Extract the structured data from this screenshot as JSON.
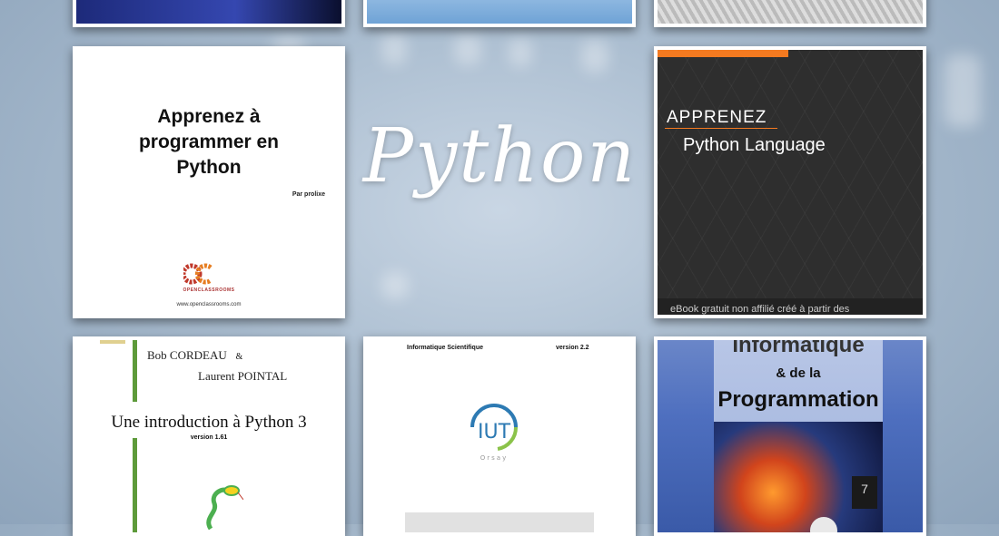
{
  "center_script": "Python",
  "books": {
    "openclassrooms": {
      "title_line1": "Apprenez à",
      "title_line2": "programmer en",
      "title_line3": "Python",
      "byline": "Par prolixe",
      "logo_text": "OPENCLASSROOMS",
      "url": "www.openclassrooms.com",
      "logo_colors": [
        "#c0392b",
        "#e67e22"
      ]
    },
    "apprenez": {
      "heading": "APPRENEZ",
      "subtitle": "Python Language",
      "footer": "eBook gratuit non affilié créé à partir des",
      "accent_color": "#f47a20"
    },
    "cordeau": {
      "author1": "Bob CORDEAU",
      "author_amp": "&",
      "author2": "Laurent POINTAL",
      "title": "Une introduction à Python 3",
      "version": "version 1.61",
      "accent_color": "#5d9a3a"
    },
    "iut": {
      "left_header": "Informatique Scientifique",
      "right_header": "version 2.2",
      "logo_text": "IUT",
      "logo_subtext": "Orsay"
    },
    "informatique": {
      "line1": "Informatique",
      "line2": "& de la",
      "line3": "Programmation",
      "badge": "7"
    }
  }
}
